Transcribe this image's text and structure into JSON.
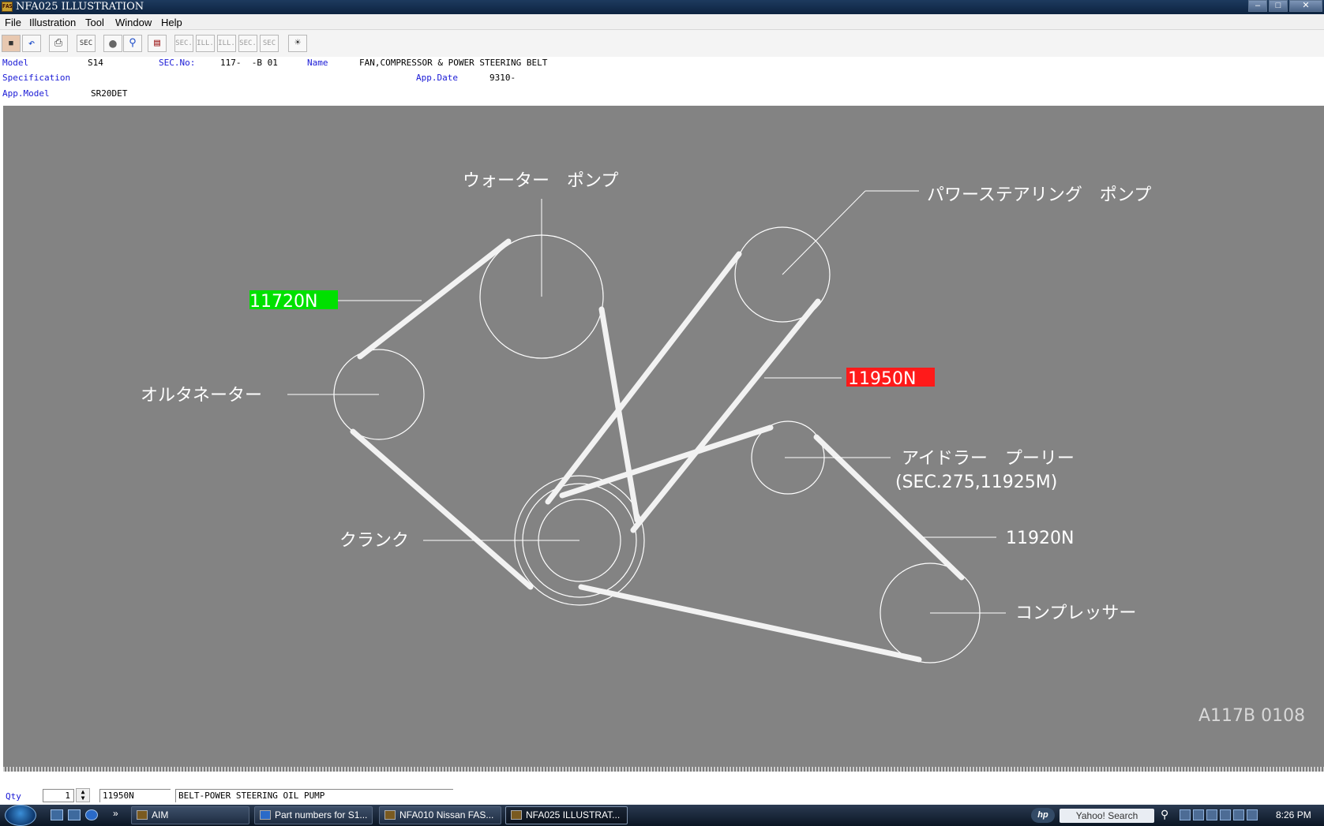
{
  "window": {
    "title": "NFA025  ILLUSTRATION",
    "icon": "nfa-app-icon"
  },
  "menu": [
    "File",
    "Illustration",
    "Tool",
    "Window",
    "Help"
  ],
  "toolbar": {
    "buttons": [
      "exit",
      "undo",
      "print",
      "sec",
      "record",
      "search",
      "book",
      "sec-prev",
      "ill-prev",
      "ill-next",
      "sec-next",
      "sec-query",
      "help"
    ],
    "labels": {
      "sec": "SEC",
      "sec_prev": "SEC.",
      "ill_prev": "ILL.",
      "ill_next": "ILL.",
      "sec_next": "SEC.",
      "sec_query": "SEC"
    }
  },
  "header": {
    "model_label": "Model",
    "model_value": "S14",
    "sec_label": "SEC.No:",
    "sec_value": "117-  -B 01",
    "name_label": "Name",
    "name_value": "FAN,COMPRESSOR & POWER STEERING BELT",
    "spec_label": "Specification",
    "appdate_label": "App.Date",
    "appdate_value": "9310-",
    "appmodel_label": "App.Model",
    "appmodel_value": "SR20DET"
  },
  "illustration": {
    "labels": {
      "water_pump": "ウォーター　ポンプ",
      "ps_pump": "パワーステアリング　ポンプ",
      "alternator": "オルタネーター",
      "idler": "アイドラー　プーリー",
      "idler_ref": "(SEC.275,11925M)",
      "crank": "クランク",
      "compressor": "コンプレッサー",
      "part_11720": "11720N",
      "part_11950": "11950N",
      "part_11920": "11920N",
      "ref_code": "A117B 0108"
    },
    "colors": {
      "background": "#838383",
      "line": "#ffffff",
      "highlight_green": "#00e000",
      "highlight_red": "#ff1a1a"
    }
  },
  "status": {
    "qty_label": "Qty",
    "qty_value": "1",
    "part_no": "11950N",
    "description": "BELT-POWER STEERING OIL PUMP"
  },
  "taskbar": {
    "tasks": [
      "AIM",
      "Part numbers for S1...",
      "NFA010 Nissan FAS...",
      "NFA025  ILLUSTRAT..."
    ],
    "search_placeholder": "Yahoo! Search",
    "clock": "8:26 PM",
    "hp_label": "hp"
  }
}
